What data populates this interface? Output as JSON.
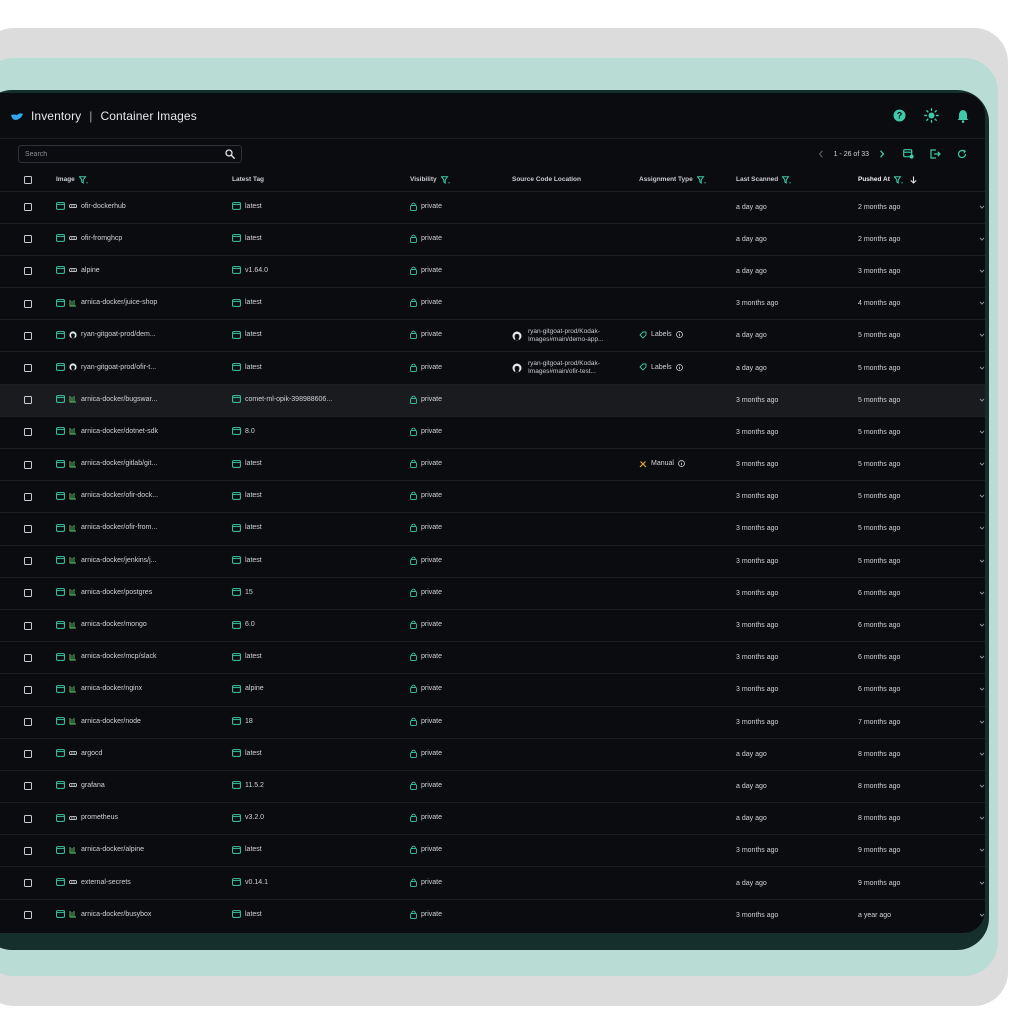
{
  "header": {
    "section": "Inventory",
    "separator": "|",
    "page": "Container Images"
  },
  "toolbar": {
    "search_placeholder": "Search",
    "pagination": "1 - 26 of 33"
  },
  "colors": {
    "accent": "#3fc9a8",
    "logo": "#2ea8f0",
    "help_icon": "#3fc9a8",
    "theme_icon": "#3fc9a8",
    "bell_icon": "#3fc9a8",
    "manual_icon": "#e8a33a"
  },
  "columns": {
    "image": "Image",
    "latest_tag": "Latest Tag",
    "visibility": "Visibility",
    "source": "Source Code Location",
    "assignment": "Assignment Type",
    "last_scanned": "Last Scanned",
    "pushed_at": "Pushed At"
  },
  "rows": [
    {
      "registry_icon": "dockerhub-icon",
      "image": "ofir-dockerhub",
      "tag": "latest",
      "visibility": "private",
      "source": "",
      "assignment": "",
      "last_scanned": "a day ago",
      "pushed_at": "2 months ago"
    },
    {
      "registry_icon": "dockerhub-icon",
      "image": "ofir-fromghcp",
      "tag": "latest",
      "visibility": "private",
      "source": "",
      "assignment": "",
      "last_scanned": "a day ago",
      "pushed_at": "2 months ago"
    },
    {
      "registry_icon": "dockerhub-icon",
      "image": "alpine",
      "tag": "v1.64.0",
      "visibility": "private",
      "source": "",
      "assignment": "",
      "last_scanned": "a day ago",
      "pushed_at": "3 months ago"
    },
    {
      "registry_icon": "artifactory-icon",
      "image": "arnica-docker/juice-shop",
      "tag": "latest",
      "visibility": "private",
      "source": "",
      "assignment": "",
      "last_scanned": "3 months ago",
      "pushed_at": "4 months ago"
    },
    {
      "registry_icon": "github-icon",
      "image": "ryan-gitgoat-prod/dem...",
      "tag": "latest",
      "visibility": "private",
      "source": "ryan-gitgoat-prod/Kodak-Images#main/demo-app...",
      "assignment": "Labels",
      "last_scanned": "a day ago",
      "pushed_at": "5 months ago"
    },
    {
      "registry_icon": "github-icon",
      "image": "ryan-gitgoat-prod/ofir-t...",
      "tag": "latest",
      "visibility": "private",
      "source": "ryan-gitgoat-prod/Kodak-Images#main/ofir-test...",
      "assignment": "Labels",
      "last_scanned": "a day ago",
      "pushed_at": "5 months ago"
    },
    {
      "registry_icon": "artifactory-icon",
      "image": "arnica-docker/bugswar...",
      "tag": "comet-ml-opik-398988606...",
      "visibility": "private",
      "source": "",
      "assignment": "",
      "last_scanned": "3 months ago",
      "pushed_at": "5 months ago"
    },
    {
      "registry_icon": "artifactory-icon",
      "image": "arnica-docker/dotnet-sdk",
      "tag": "8.0",
      "visibility": "private",
      "source": "",
      "assignment": "",
      "last_scanned": "3 months ago",
      "pushed_at": "5 months ago"
    },
    {
      "registry_icon": "artifactory-icon",
      "image": "arnica-docker/gitlab/git...",
      "tag": "latest",
      "visibility": "private",
      "source": "",
      "assignment": "Manual",
      "last_scanned": "3 months ago",
      "pushed_at": "5 months ago"
    },
    {
      "registry_icon": "artifactory-icon",
      "image": "arnica-docker/ofir-dock...",
      "tag": "latest",
      "visibility": "private",
      "source": "",
      "assignment": "",
      "last_scanned": "3 months ago",
      "pushed_at": "5 months ago"
    },
    {
      "registry_icon": "artifactory-icon",
      "image": "arnica-docker/ofir-from...",
      "tag": "latest",
      "visibility": "private",
      "source": "",
      "assignment": "",
      "last_scanned": "3 months ago",
      "pushed_at": "5 months ago"
    },
    {
      "registry_icon": "artifactory-icon",
      "image": "arnica-docker/jenkins/j...",
      "tag": "latest",
      "visibility": "private",
      "source": "",
      "assignment": "",
      "last_scanned": "3 months ago",
      "pushed_at": "5 months ago"
    },
    {
      "registry_icon": "artifactory-icon",
      "image": "arnica-docker/postgres",
      "tag": "15",
      "visibility": "private",
      "source": "",
      "assignment": "",
      "last_scanned": "3 months ago",
      "pushed_at": "6 months ago"
    },
    {
      "registry_icon": "artifactory-icon",
      "image": "arnica-docker/mongo",
      "tag": "6.0",
      "visibility": "private",
      "source": "",
      "assignment": "",
      "last_scanned": "3 months ago",
      "pushed_at": "6 months ago"
    },
    {
      "registry_icon": "artifactory-icon",
      "image": "arnica-docker/mcp/slack",
      "tag": "latest",
      "visibility": "private",
      "source": "",
      "assignment": "",
      "last_scanned": "3 months ago",
      "pushed_at": "6 months ago"
    },
    {
      "registry_icon": "artifactory-icon",
      "image": "arnica-docker/nginx",
      "tag": "alpine",
      "visibility": "private",
      "source": "",
      "assignment": "",
      "last_scanned": "3 months ago",
      "pushed_at": "6 months ago"
    },
    {
      "registry_icon": "artifactory-icon",
      "image": "arnica-docker/node",
      "tag": "18",
      "visibility": "private",
      "source": "",
      "assignment": "",
      "last_scanned": "3 months ago",
      "pushed_at": "7 months ago"
    },
    {
      "registry_icon": "dockerhub-icon",
      "image": "argocd",
      "tag": "latest",
      "visibility": "private",
      "source": "",
      "assignment": "",
      "last_scanned": "a day ago",
      "pushed_at": "8 months ago"
    },
    {
      "registry_icon": "dockerhub-icon",
      "image": "grafana",
      "tag": "11.5.2",
      "visibility": "private",
      "source": "",
      "assignment": "",
      "last_scanned": "a day ago",
      "pushed_at": "8 months ago"
    },
    {
      "registry_icon": "dockerhub-icon",
      "image": "prometheus",
      "tag": "v3.2.0",
      "visibility": "private",
      "source": "",
      "assignment": "",
      "last_scanned": "a day ago",
      "pushed_at": "8 months ago"
    },
    {
      "registry_icon": "artifactory-icon",
      "image": "arnica-docker/alpine",
      "tag": "latest",
      "visibility": "private",
      "source": "",
      "assignment": "",
      "last_scanned": "3 months ago",
      "pushed_at": "9 months ago"
    },
    {
      "registry_icon": "dockerhub-icon",
      "image": "external-secrets",
      "tag": "v0.14.1",
      "visibility": "private",
      "source": "",
      "assignment": "",
      "last_scanned": "a day ago",
      "pushed_at": "9 months ago"
    },
    {
      "registry_icon": "artifactory-icon",
      "image": "arnica-docker/busybox",
      "tag": "latest",
      "visibility": "private",
      "source": "",
      "assignment": "",
      "last_scanned": "3 months ago",
      "pushed_at": "a year ago"
    }
  ],
  "highlighted_row": 6
}
